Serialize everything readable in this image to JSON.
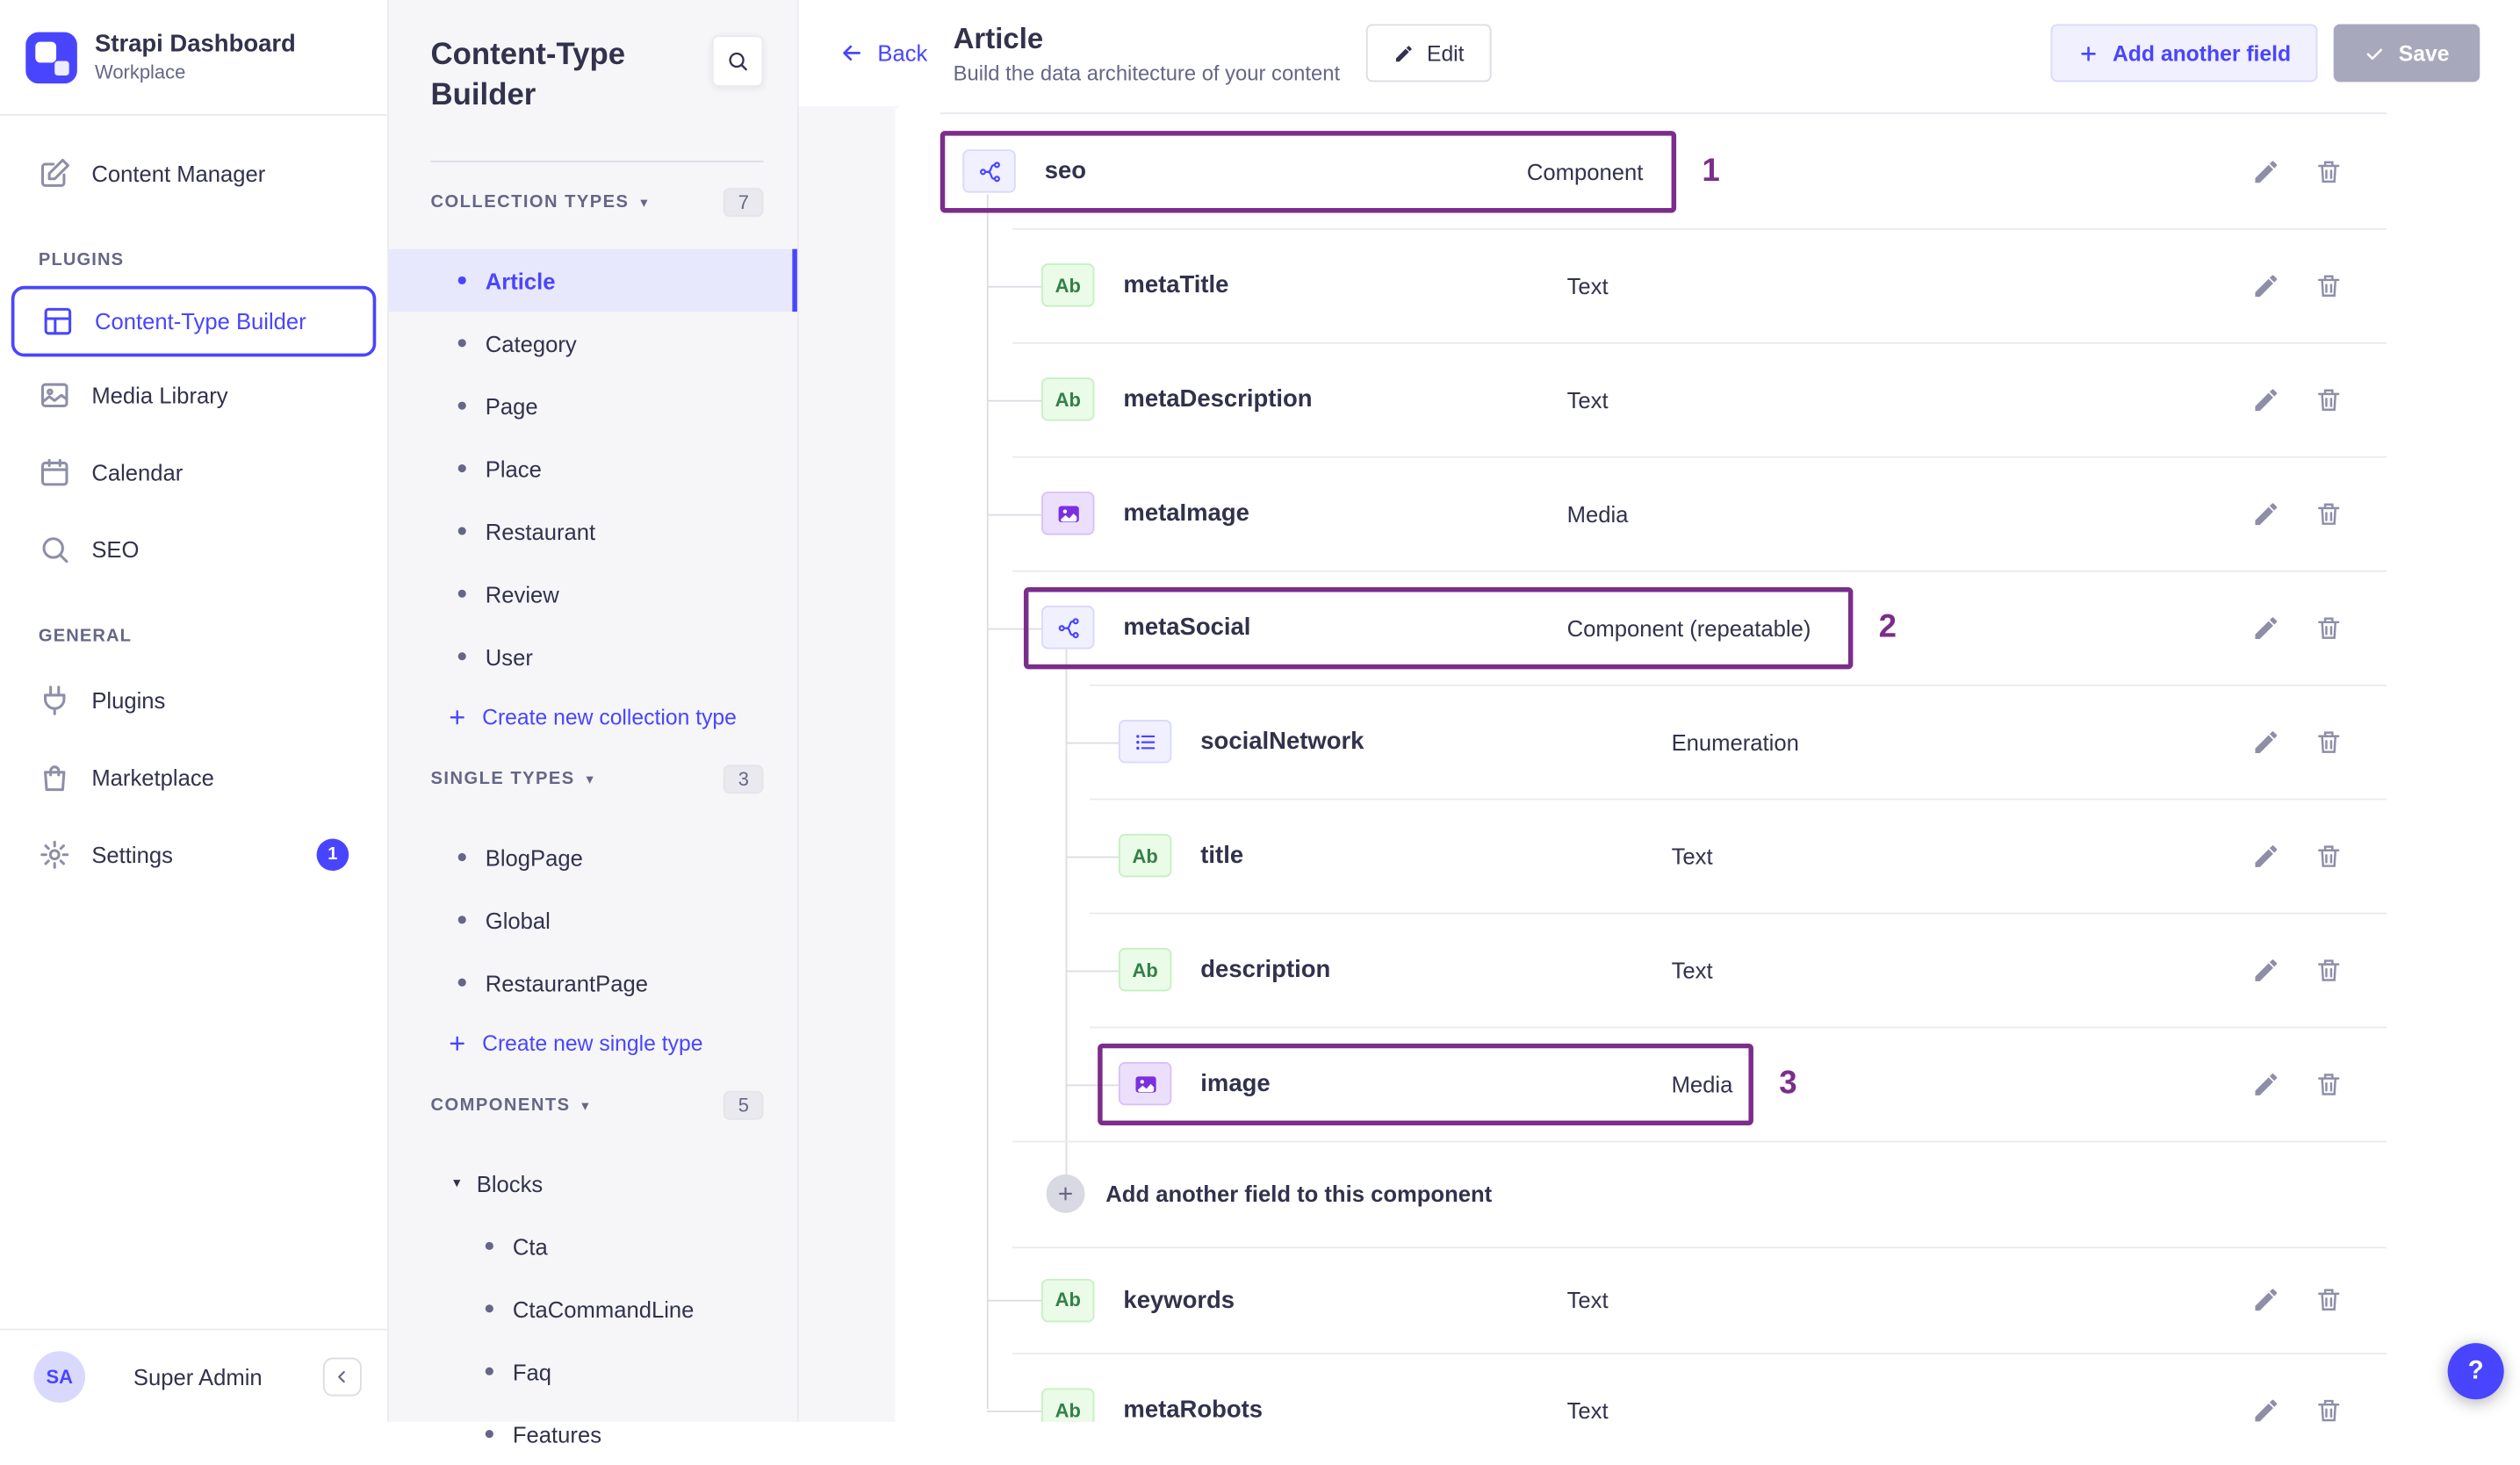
{
  "theme": {
    "primary": "#4945ff",
    "primary_light": "#f0f0ff",
    "annotation": "#7b2d8b",
    "page_bg": "#f6f6f9",
    "border": "#eaeaef",
    "text": "#32324d",
    "muted": "#666687"
  },
  "sidebar": {
    "brand": {
      "name": "Strapi Dashboard",
      "workspace": "Workplace"
    },
    "content_manager": "Content Manager",
    "plugins_label": "PLUGINS",
    "plugins": [
      "Content-Type Builder",
      "Media Library",
      "Calendar",
      "SEO"
    ],
    "general_label": "GENERAL",
    "general": [
      "Plugins",
      "Marketplace",
      "Settings"
    ],
    "settings_badge": "1",
    "user": {
      "initials": "SA",
      "name": "Super Admin"
    }
  },
  "builder_panel": {
    "title": "Content-Type Builder",
    "collection_types": {
      "label": "COLLECTION TYPES",
      "count": "7",
      "items": [
        "Article",
        "Category",
        "Page",
        "Place",
        "Restaurant",
        "Review",
        "User"
      ],
      "create_label": "Create new collection type"
    },
    "single_types": {
      "label": "SINGLE TYPES",
      "count": "3",
      "items": [
        "BlogPage",
        "Global",
        "RestaurantPage"
      ],
      "create_label": "Create new single type"
    },
    "components": {
      "label": "COMPONENTS",
      "count": "5",
      "group_label": "Blocks",
      "items": [
        "Cta",
        "CtaCommandLine",
        "Faq",
        "Features"
      ]
    }
  },
  "header": {
    "back_label": "Back",
    "title": "Article",
    "subtitle": "Build the data architecture of your content",
    "edit_label": "Edit",
    "add_field_label": "Add another field",
    "save_label": "Save"
  },
  "fields": {
    "text_badge": "Ab",
    "rows": [
      {
        "name": "seo",
        "type": "Component",
        "annotation": "1"
      },
      {
        "name": "metaTitle",
        "type": "Text"
      },
      {
        "name": "metaDescription",
        "type": "Text"
      },
      {
        "name": "metaImage",
        "type": "Media"
      },
      {
        "name": "metaSocial",
        "type": "Component (repeatable)",
        "annotation": "2"
      },
      {
        "name": "socialNetwork",
        "type": "Enumeration"
      },
      {
        "name": "title",
        "type": "Text"
      },
      {
        "name": "description",
        "type": "Text"
      },
      {
        "name": "image",
        "type": "Media",
        "annotation": "3"
      },
      {
        "name": "keywords",
        "type": "Text"
      },
      {
        "name": "metaRobots",
        "type": "Text"
      }
    ],
    "add_note": "Add another field to this component"
  },
  "help_label": "?"
}
